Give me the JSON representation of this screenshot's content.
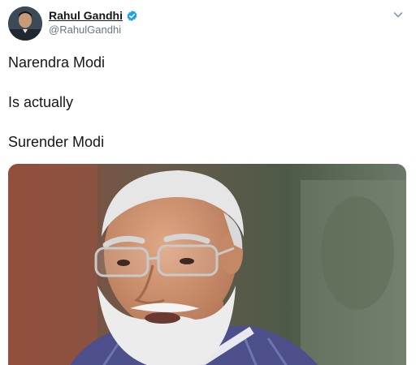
{
  "tweet": {
    "author": {
      "display_name": "Rahul Gandhi",
      "handle": "@RahulGandhi",
      "verified": true,
      "avatar_icon": "profile-photo"
    },
    "menu_icon": "chevron-down-icon",
    "text_lines": [
      "Narendra Modi",
      "Is actually",
      "Surender Modi"
    ],
    "media": {
      "type": "photo",
      "alt": "Photo of an elderly man with white hair and beard wearing glasses"
    }
  },
  "colors": {
    "text": "#14171a",
    "secondary": "#657786",
    "verified": "#1da1f2"
  }
}
